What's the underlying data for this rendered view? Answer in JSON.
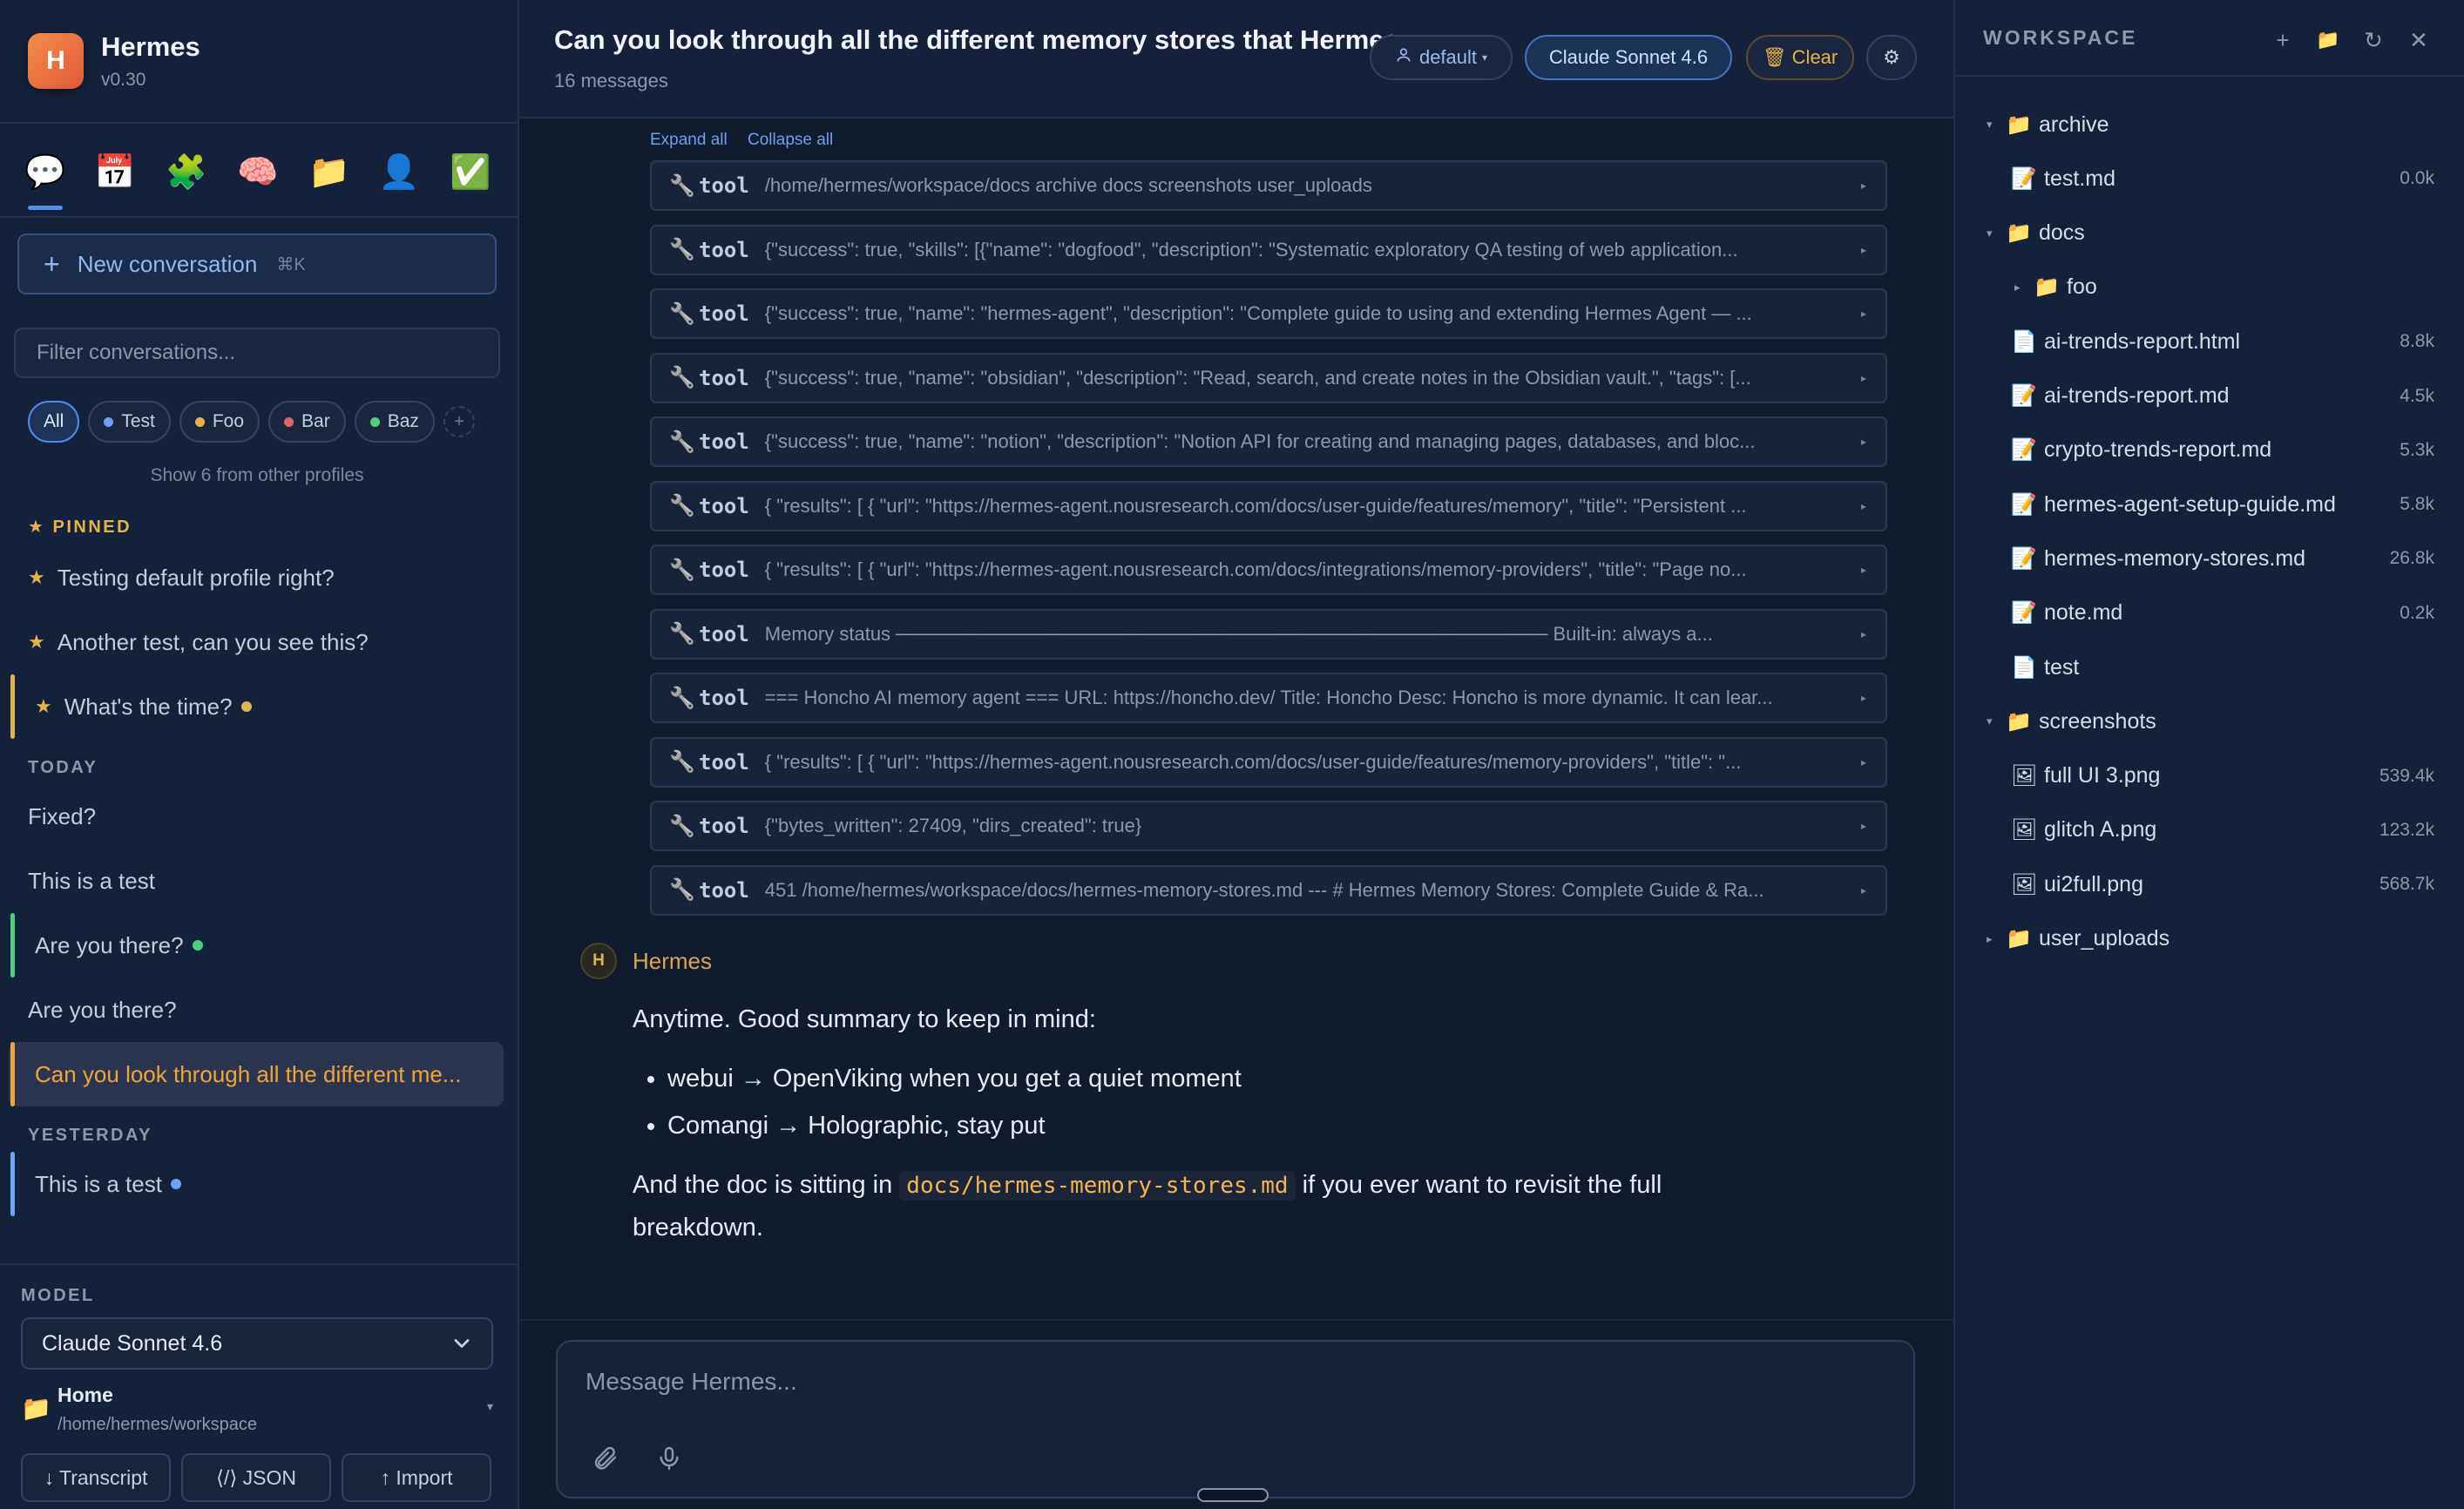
{
  "brand": {
    "name": "Hermes",
    "logo_letter": "H",
    "version": "v0.30"
  },
  "nav_icons": [
    {
      "name": "chat",
      "glyph": "💬"
    },
    {
      "name": "calendar",
      "glyph": "📅"
    },
    {
      "name": "skills",
      "glyph": "🧩"
    },
    {
      "name": "memory",
      "glyph": "🧠"
    },
    {
      "name": "files",
      "glyph": "📁"
    },
    {
      "name": "profile",
      "glyph": "👤"
    },
    {
      "name": "tasks",
      "glyph": "✅"
    }
  ],
  "sidebar": {
    "new_conversation": "New conversation",
    "new_conversation_shortcut": "⌘K",
    "filter_placeholder": "Filter conversations...",
    "chips": [
      {
        "label": "All",
        "active": true,
        "color": ""
      },
      {
        "label": "Test",
        "active": false,
        "color": "#6fa2f2"
      },
      {
        "label": "Foo",
        "active": false,
        "color": "#e6b34a"
      },
      {
        "label": "Bar",
        "active": false,
        "color": "#e6606a"
      },
      {
        "label": "Baz",
        "active": false,
        "color": "#4fcf7a"
      }
    ],
    "other_profiles": "Show 6 from other profiles",
    "pinned_label": "PINNED",
    "today_label": "TODAY",
    "yesterday_label": "YESTERDAY",
    "pinned": [
      {
        "title": "Testing default profile right?"
      },
      {
        "title": "Another test, can you see this?"
      },
      {
        "title": "What's the time?"
      }
    ],
    "today": [
      {
        "title": "Fixed?"
      },
      {
        "title": "This is a test"
      },
      {
        "title": "Are you there?"
      },
      {
        "title": "Are you there?"
      },
      {
        "title": "Can you look through all the different me..."
      }
    ],
    "yesterday": [
      {
        "title": "This is a test"
      }
    ],
    "model_label": "MODEL",
    "model_value": "Claude Sonnet 4.6",
    "workspace_title": "Home",
    "workspace_path": "/home/hermes/workspace",
    "buttons": {
      "transcript": "↓ Transcript",
      "json": "⟨/⟩ JSON",
      "import": "↑ Import"
    }
  },
  "chat": {
    "title": "Can you look through all the different memory stores that Hermes",
    "subtitle": "16 messages",
    "profile_pill": "default",
    "model_pill": "Claude Sonnet 4.6",
    "clear_label": "Clear",
    "expand_all": "Expand all",
    "collapse_all": "Collapse all",
    "tool_label": "tool",
    "tools": [
      "/home/hermes/workspace/docs archive docs screenshots user_uploads",
      "{\"success\": true, \"skills\": [{\"name\": \"dogfood\", \"description\": \"Systematic exploratory QA testing of web application...",
      "{\"success\": true, \"name\": \"hermes-agent\", \"description\": \"Complete guide to using and extending Hermes Agent — ...",
      "{\"success\": true, \"name\": \"obsidian\", \"description\": \"Read, search, and create notes in the Obsidian vault.\", \"tags\": [...",
      "{\"success\": true, \"name\": \"notion\", \"description\": \"Notion API for creating and managing pages, databases, and bloc...",
      "{ \"results\": [ { \"url\": \"https://hermes-agent.nousresearch.com/docs/user-guide/features/memory\", \"title\": \"Persistent ...",
      "{ \"results\": [ { \"url\": \"https://hermes-agent.nousresearch.com/docs/integrations/memory-providers\", \"title\": \"Page no...",
      "Memory status ──────────────────────────────────────────────── Built-in: always a...",
      "=== Honcho AI memory agent === URL: https://honcho.dev/ Title: Honcho Desc: Honcho is more dynamic. It can lear...",
      "{ \"results\": [ { \"url\": \"https://hermes-agent.nousresearch.com/docs/user-guide/features/memory-providers\", \"title\": \"...",
      "{\"bytes_written\": 27409, \"dirs_created\": true}",
      "451 /home/hermes/workspace/docs/hermes-memory-stores.md --- # Hermes Memory Stores: Complete Guide & Ra..."
    ],
    "assistant_name": "Hermes",
    "assistant_avatar": "H",
    "message": {
      "intro": "Anytime. Good summary to keep in mind:",
      "bullets": [
        "webui → OpenViking when you get a quiet moment",
        "Comangi → Holographic, stay put"
      ],
      "outro_before": "And the doc is sitting in ",
      "outro_code": "docs/hermes-memory-stores.md",
      "outro_after": " if you ever want to revisit the full breakdown."
    },
    "composer_placeholder": "Message Hermes..."
  },
  "workspace": {
    "title": "WORKSPACE",
    "tree": [
      {
        "name": "archive",
        "type": "folder",
        "depth": 0,
        "expanded": true,
        "size": ""
      },
      {
        "name": "test.md",
        "type": "md",
        "depth": 1,
        "size": "0.0k"
      },
      {
        "name": "docs",
        "type": "folder",
        "depth": 0,
        "expanded": true,
        "size": ""
      },
      {
        "name": "foo",
        "type": "folder",
        "depth": 1,
        "expanded": false,
        "size": ""
      },
      {
        "name": "ai-trends-report.html",
        "type": "file",
        "depth": 1,
        "size": "8.8k"
      },
      {
        "name": "ai-trends-report.md",
        "type": "md",
        "depth": 1,
        "size": "4.5k"
      },
      {
        "name": "crypto-trends-report.md",
        "type": "md",
        "depth": 1,
        "size": "5.3k"
      },
      {
        "name": "hermes-agent-setup-guide.md",
        "type": "md",
        "depth": 1,
        "size": "5.8k"
      },
      {
        "name": "hermes-memory-stores.md",
        "type": "md",
        "depth": 1,
        "size": "26.8k"
      },
      {
        "name": "note.md",
        "type": "md",
        "depth": 1,
        "size": "0.2k"
      },
      {
        "name": "test",
        "type": "file",
        "depth": 1,
        "size": ""
      },
      {
        "name": "screenshots",
        "type": "folder",
        "depth": 0,
        "expanded": true,
        "size": ""
      },
      {
        "name": "full UI 3.png",
        "type": "image",
        "depth": 1,
        "size": "539.4k"
      },
      {
        "name": "glitch A.png",
        "type": "image",
        "depth": 1,
        "size": "123.2k"
      },
      {
        "name": "ui2full.png",
        "type": "image",
        "depth": 1,
        "size": "568.7k"
      },
      {
        "name": "user_uploads",
        "type": "folder",
        "depth": 0,
        "expanded": false,
        "size": ""
      }
    ]
  },
  "colors": {
    "accent": "#4f8cf0",
    "active_conversation": "#f0a43e",
    "pinned": "#e6b34a"
  }
}
